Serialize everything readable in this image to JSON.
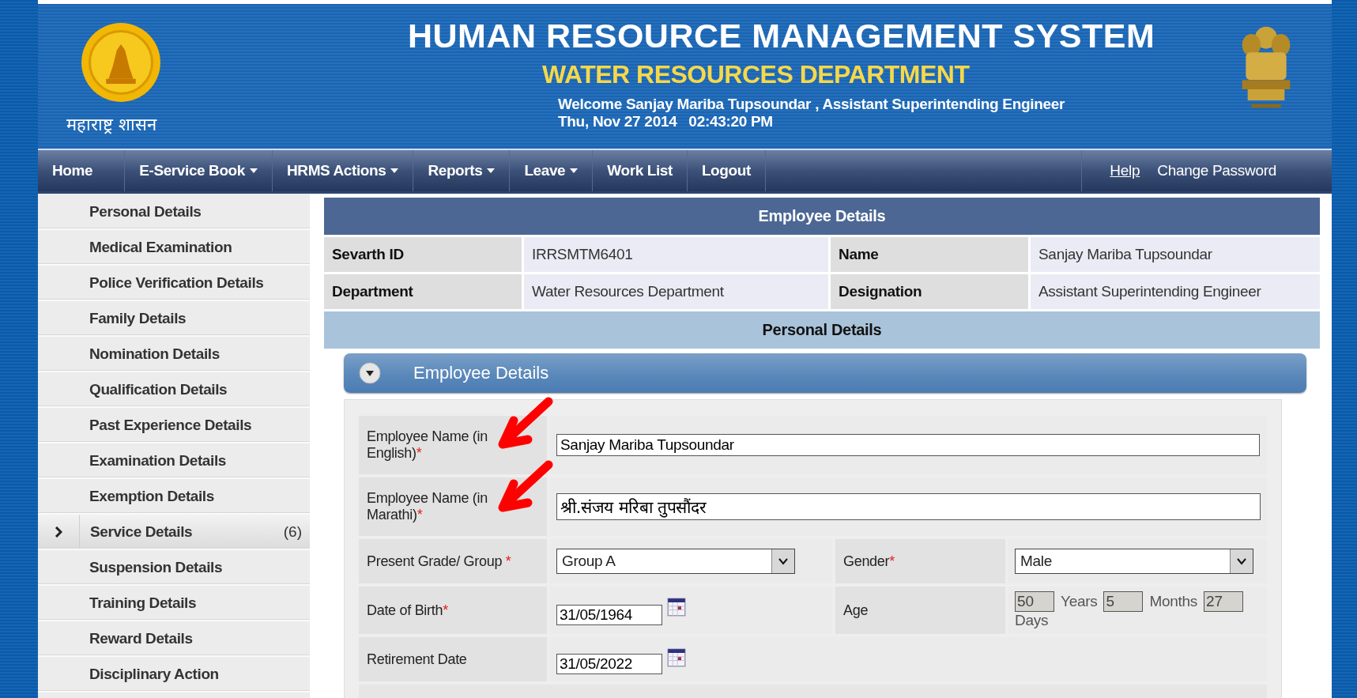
{
  "header": {
    "state_name": "महाराष्ट्र शासन",
    "title": "HUMAN RESOURCE MANAGEMENT SYSTEM",
    "subtitle": "WATER RESOURCES DEPARTMENT",
    "welcome": "Welcome Sanjay Mariba Tupsoundar , Assistant Superintending Engineer",
    "datetime": "Thu, Nov 27 2014   02:43:20 PM"
  },
  "nav": {
    "items": [
      {
        "label": "Home",
        "dropdown": false
      },
      {
        "label": "E-Service Book",
        "dropdown": true
      },
      {
        "label": "HRMS Actions",
        "dropdown": true
      },
      {
        "label": "Reports",
        "dropdown": true
      },
      {
        "label": "Leave",
        "dropdown": true
      },
      {
        "label": "Work List",
        "dropdown": false
      },
      {
        "label": "Logout",
        "dropdown": false
      }
    ],
    "right_links": [
      {
        "label": "Help",
        "underlined": true
      },
      {
        "label": "Change Password",
        "underlined": false
      }
    ]
  },
  "sidebar": {
    "items": [
      {
        "label": "Personal Details",
        "selected": false
      },
      {
        "label": "Medical Examination",
        "selected": false
      },
      {
        "label": "Police Verification Details",
        "selected": false
      },
      {
        "label": "Family Details",
        "selected": false
      },
      {
        "label": "Nomination Details",
        "selected": false
      },
      {
        "label": "Qualification Details",
        "selected": false
      },
      {
        "label": "Past Experience Details",
        "selected": false
      },
      {
        "label": "Examination Details",
        "selected": false
      },
      {
        "label": "Exemption Details",
        "selected": false
      },
      {
        "label": "Service Details",
        "selected": true,
        "count": "(6)"
      },
      {
        "label": "Suspension Details",
        "selected": false
      },
      {
        "label": "Training Details",
        "selected": false
      },
      {
        "label": "Reward Details",
        "selected": false
      },
      {
        "label": "Disciplinary Action",
        "selected": false
      }
    ]
  },
  "employee_details": {
    "title": "Employee Details",
    "rows": [
      [
        {
          "label": "Sevarth ID",
          "value": "IRRSMTM6401"
        },
        {
          "label": "Name",
          "value": "Sanjay Mariba Tupsoundar"
        }
      ],
      [
        {
          "label": "Department",
          "value": "Water Resources Department"
        },
        {
          "label": "Designation",
          "value": "Assistant Superintending Engineer"
        }
      ]
    ]
  },
  "section_title": "Personal Details",
  "panel": {
    "title": "Employee Details",
    "expanded": true
  },
  "form": {
    "rows": [
      {
        "cells": [
          {
            "label": "Employee Name (in English)",
            "required_mark": "*",
            "field": {
              "kind": "text",
              "value": "Sanjay Mariba Tupsoundar"
            }
          }
        ]
      },
      {
        "cells": [
          {
            "label": "Employee Name (in Marathi)",
            "required_mark": "*",
            "field": {
              "kind": "text",
              "value": "श्री.संजय मरिबा तुपसौंदर"
            }
          }
        ]
      },
      {
        "cells": [
          {
            "label": "Present Grade/ Group",
            "required_mark": " *",
            "field": {
              "kind": "select",
              "value": "Group A"
            }
          },
          {
            "label": "Gender",
            "required_mark": "*",
            "field": {
              "kind": "select",
              "value": "Male"
            }
          }
        ]
      },
      {
        "cells": [
          {
            "label": "Date of Birth",
            "required_mark": "*",
            "field": {
              "kind": "date",
              "value": "31/05/1964"
            }
          },
          {
            "label": "Age",
            "field": {
              "kind": "age",
              "years": "50",
              "years_unit": "Years",
              "months": "5",
              "months_unit": "Months",
              "days": "27",
              "days_unit": "Days"
            }
          }
        ]
      },
      {
        "cells": [
          {
            "label": "Retirement Date",
            "field": {
              "kind": "date",
              "value": "31/05/2022"
            }
          }
        ]
      }
    ]
  }
}
